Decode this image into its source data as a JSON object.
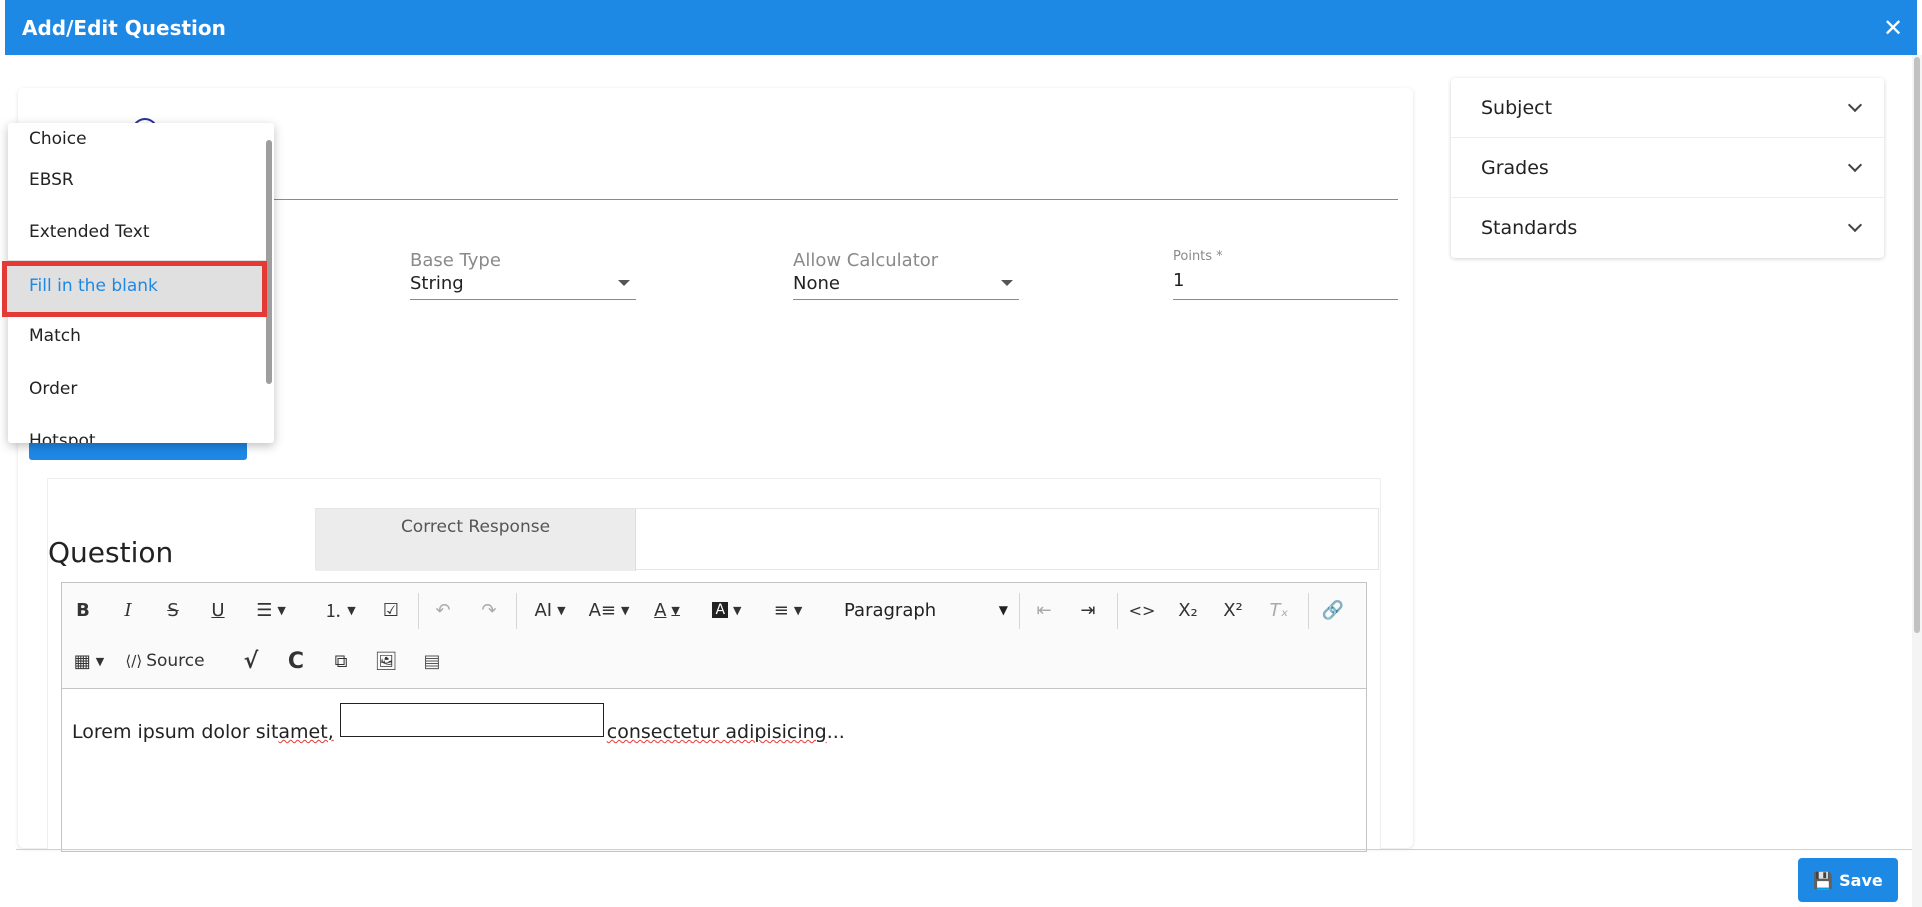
{
  "header": {
    "title": "Add/Edit Question",
    "close_icon": "close-icon"
  },
  "question_type_dropdown": {
    "items": [
      "Choice",
      "EBSR",
      "Extended Text",
      "Fill in the blank",
      "Match",
      "Order",
      "Hotspot"
    ],
    "selected": "Fill in the blank"
  },
  "fields": {
    "base_type": {
      "label": "Base Type",
      "value": "String"
    },
    "allow_calculator": {
      "label": "Allow Calculator",
      "value": "None"
    },
    "points": {
      "label": "Points *",
      "value": "1"
    }
  },
  "question": {
    "title": "Question",
    "tabs": [
      "Correct Response"
    ],
    "editor": {
      "paragraph_select": "Paragraph",
      "source_label": "Source",
      "content_before": "Lorem ipsum dolor sit ",
      "content_misspelled1": "amet,",
      "content_after_pre": "",
      "content_misspelled2": "consectetur adipisicing",
      "content_tail": " ..."
    }
  },
  "sidebar": {
    "accordion": [
      {
        "label": "Subject"
      },
      {
        "label": "Grades"
      },
      {
        "label": "Standards"
      }
    ]
  },
  "footer": {
    "save_label": "Save"
  },
  "colors": {
    "primary": "#1e88e5",
    "highlight": "#e53935"
  }
}
